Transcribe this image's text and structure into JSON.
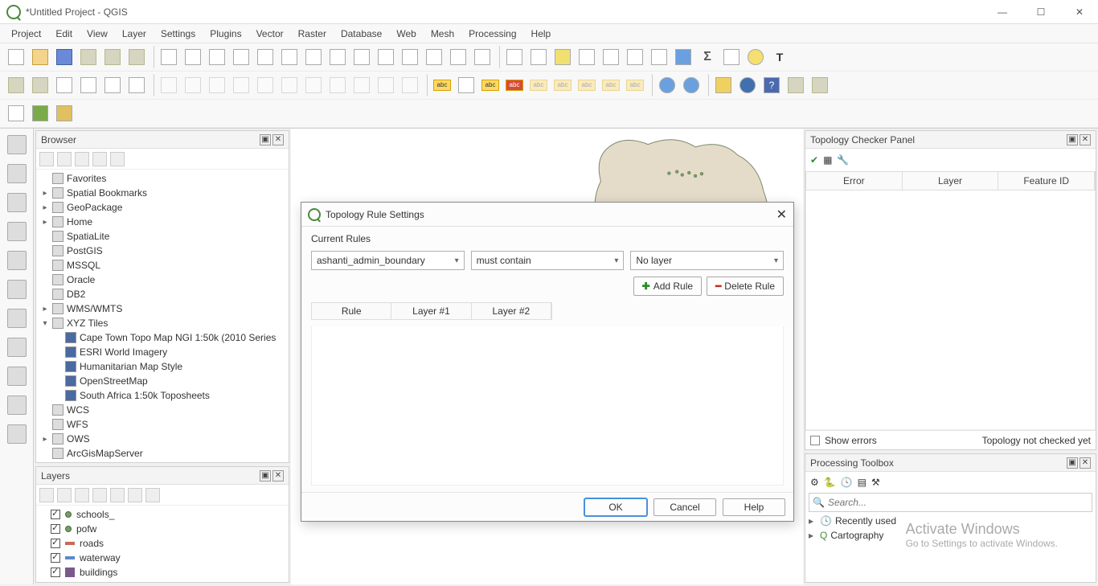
{
  "window": {
    "title": "*Untitled Project - QGIS"
  },
  "menu": [
    "Project",
    "Edit",
    "View",
    "Layer",
    "Settings",
    "Plugins",
    "Vector",
    "Raster",
    "Database",
    "Web",
    "Mesh",
    "Processing",
    "Help"
  ],
  "browser": {
    "title": "Browser",
    "items": [
      {
        "label": "Favorites",
        "exp": "",
        "ic": "star"
      },
      {
        "label": "Spatial Bookmarks",
        "exp": "▸",
        "ic": "bm"
      },
      {
        "label": "GeoPackage",
        "exp": "▸",
        "ic": "gp"
      },
      {
        "label": "Home",
        "exp": "▸",
        "ic": "home"
      },
      {
        "label": "SpatiaLite",
        "exp": "",
        "ic": "sl"
      },
      {
        "label": "PostGIS",
        "exp": "",
        "ic": "pg"
      },
      {
        "label": "MSSQL",
        "exp": "",
        "ic": "ms"
      },
      {
        "label": "Oracle",
        "exp": "",
        "ic": "or"
      },
      {
        "label": "DB2",
        "exp": "",
        "ic": "db2"
      },
      {
        "label": "WMS/WMTS",
        "exp": "▸",
        "ic": "wms"
      },
      {
        "label": "XYZ Tiles",
        "exp": "▾",
        "ic": "xyz",
        "children": [
          "Cape Town Topo Map NGI 1:50k (2010 Series",
          "ESRI World Imagery",
          "Humanitarian Map Style",
          "OpenStreetMap",
          "South Africa 1:50k Toposheets"
        ]
      },
      {
        "label": "WCS",
        "exp": "",
        "ic": "wcs"
      },
      {
        "label": "WFS",
        "exp": "",
        "ic": "wfs"
      },
      {
        "label": "OWS",
        "exp": "▸",
        "ic": "ows"
      },
      {
        "label": "ArcGisMapServer",
        "exp": "",
        "ic": "ags"
      }
    ]
  },
  "layers": {
    "title": "Layers",
    "items": [
      {
        "name": "schools_",
        "checked": true,
        "type": "point"
      },
      {
        "name": "pofw",
        "checked": true,
        "type": "point"
      },
      {
        "name": "roads",
        "checked": true,
        "type": "line",
        "color": "#c86a5a"
      },
      {
        "name": "waterway",
        "checked": true,
        "type": "line",
        "color": "#5a8ac8"
      },
      {
        "name": "buildings",
        "checked": true,
        "type": "poly",
        "color": "#7a5a8a"
      }
    ]
  },
  "topology_panel": {
    "title": "Topology Checker Panel",
    "columns": [
      "Error",
      "Layer",
      "Feature ID"
    ],
    "show_errors_label": "Show errors",
    "status": "Topology not checked yet"
  },
  "processing": {
    "title": "Processing Toolbox",
    "search_placeholder": "Search...",
    "items": [
      "Recently used",
      "Cartography"
    ]
  },
  "dialog": {
    "title": "Topology Rule Settings",
    "current_rules_label": "Current Rules",
    "layer1": "ashanti_admin_boundary",
    "rule": "must contain",
    "layer2": "No layer",
    "add_rule": "Add Rule",
    "delete_rule": "Delete Rule",
    "columns": [
      "Rule",
      "Layer #1",
      "Layer #2"
    ],
    "ok": "OK",
    "cancel": "Cancel",
    "help": "Help"
  },
  "watermark": {
    "line1": "Activate Windows",
    "line2": "Go to Settings to activate Windows."
  }
}
